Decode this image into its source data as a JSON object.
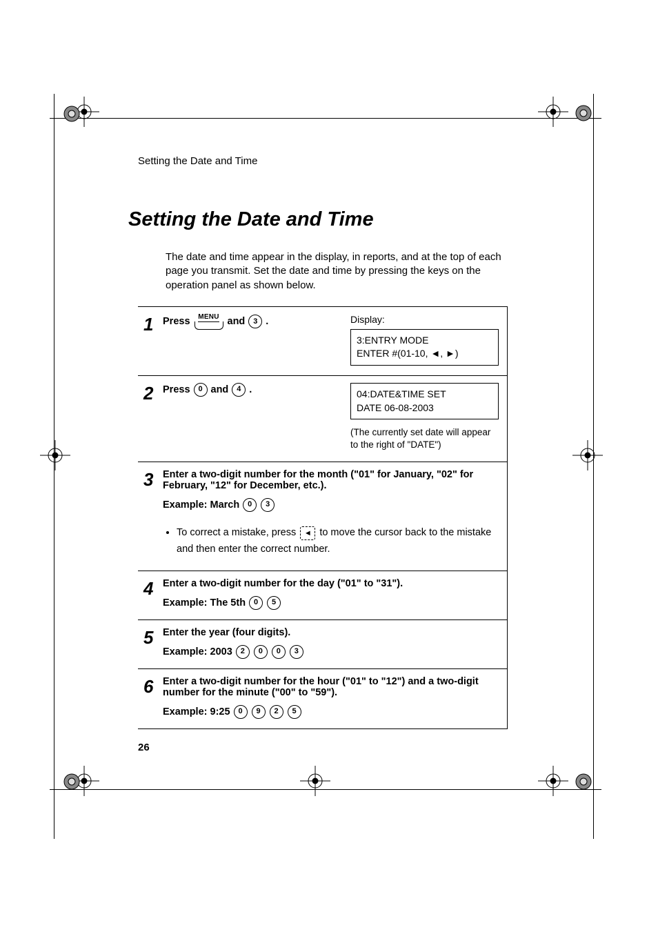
{
  "runningHead": "Setting the Date and Time",
  "title": "Setting the Date and Time",
  "intro": "The date and time appear in the display, in reports, and at the top of each page you transmit. Set the date and time by pressing the keys on the operation panel as shown below.",
  "pageNumber": "26",
  "displayLabel": "Display:",
  "steps": {
    "s1": {
      "num": "1",
      "pressWord": "Press",
      "menuLabel": "MENU",
      "andWord": "and",
      "key1": "3",
      "period": ".",
      "displayLine1": "3:ENTRY MODE",
      "displayLine2a": "ENTER #(01-10, ",
      "displayLine2b": ")"
    },
    "s2": {
      "num": "2",
      "pressWord": "Press",
      "key1": "0",
      "andWord": "and",
      "key2": "4",
      "period": ".",
      "displayLine1": "04:DATE&TIME SET",
      "displayLine2": "DATE 06-08-2003",
      "note": "(The currently set date will appear to the right of \"DATE\")"
    },
    "s3": {
      "num": "3",
      "text": "Enter a two-digit number for the month (\"01\" for January, \"02\" for February, \"12\" for December, etc.).",
      "exampleLabel": "Example: March",
      "k1": "0",
      "k2": "3",
      "bulletA": "To correct a mistake, press ",
      "bulletB": " to move the cursor back to the mistake and then enter the correct number."
    },
    "s4": {
      "num": "4",
      "text": "Enter a two-digit number for the day (\"01\" to \"31\").",
      "exampleLabel": "Example: The 5th",
      "k1": "0",
      "k2": "5"
    },
    "s5": {
      "num": "5",
      "text": "Enter the year (four digits).",
      "exampleLabel": "Example: 2003",
      "k1": "2",
      "k2": "0",
      "k3": "0",
      "k4": "3"
    },
    "s6": {
      "num": "6",
      "text": "Enter a two-digit number for the hour (\"01\" to \"12\") and a two-digit number for the minute (\"00\" to \"59\").",
      "exampleLabel": "Example: 9:25",
      "k1": "0",
      "k2": "9",
      "k3": "2",
      "k4": "5"
    }
  }
}
